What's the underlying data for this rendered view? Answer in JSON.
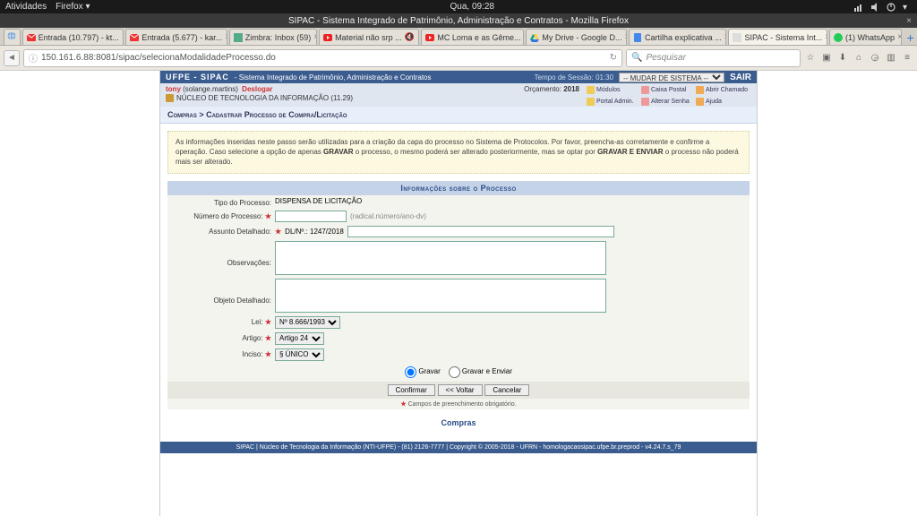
{
  "os": {
    "activities": "Atividades",
    "app": "Firefox ▾",
    "clock": "Qua, 09:28"
  },
  "firefox": {
    "window_title": "SIPAC - Sistema Integrado de Patrimônio, Administração e Contratos - Mozilla Firefox",
    "tabs": [
      {
        "label": "Entrada (10.797) - kt...",
        "icon": "gmail"
      },
      {
        "label": "Entrada (5.677) - kar...",
        "icon": "gmail"
      },
      {
        "label": "Zimbra: Inbox (59)",
        "icon": "zimbra"
      },
      {
        "label": "Material não srp ...",
        "icon": "youtube"
      },
      {
        "label": "MC Loma e as Gême...",
        "icon": "youtube"
      },
      {
        "label": "My Drive - Google D...",
        "icon": "drive"
      },
      {
        "label": "Cartilha explicativa ...",
        "icon": "doc"
      },
      {
        "label": "SIPAC - Sistema Int...",
        "icon": "sipac",
        "active": true
      },
      {
        "label": "(1) WhatsApp",
        "icon": "whatsapp"
      }
    ],
    "url": "150.161.6.88:8081/sipac/selecionaModalidadeProcesso.do",
    "search_placeholder": "Pesquisar"
  },
  "header": {
    "title": "UFPE - SIPAC",
    "subtitle": "- Sistema Integrado de Patrimônio, Administração e Contratos",
    "session": "Tempo de Sessão: 01:30",
    "sys_select": "-- MUDAR DE SISTEMA --",
    "sair": "SAIR",
    "user_prefix": "tony",
    "user_name": "(solange.martins)",
    "user_logout": "Deslogar",
    "unit": "NÚCLEO DE TECNOLOGIA DA INFORMAÇÃO (11.29)",
    "orcamento_label": "Orçamento:",
    "orcamento_year": "2018",
    "links": [
      {
        "label": "Módulos"
      },
      {
        "label": "Caixa Postal"
      },
      {
        "label": "Abrir Chamado"
      },
      {
        "label": "Portal Admin."
      },
      {
        "label": "Alterar Senha"
      },
      {
        "label": "Ajuda"
      }
    ]
  },
  "breadcrumb": "Compras > Cadastrar Processo de Compra/Licitação",
  "infobox": {
    "text1": "As informações inseridas neste passo serão utilizadas para a criação da capa do processo no Sistema de Protocolos. Por favor, preencha-as corretamente e confirme a operação. Caso selecione a opção de apenas ",
    "bold1": "GRAVAR",
    "text2": " o processo, o mesmo poderá ser alterado posteriormente, mas se optar por ",
    "bold2": "GRAVAR E ENVIAR",
    "text3": " o processo não poderá mais ser alterado."
  },
  "section_title": "Informações sobre o Processo",
  "form": {
    "tipo_label": "Tipo do Processo:",
    "tipo_value": "DISPENSA DE LICITAÇÃO",
    "numero_label": "Número do Processo:",
    "numero_hint": "(radical.número/ano-dv)",
    "assunto_label": "Assunto Detalhado:",
    "assunto_prefix": "DL/Nº.: 1247/2018",
    "obs_label": "Observações:",
    "objeto_label": "Objeto Detalhado:",
    "lei_label": "Lei:",
    "lei_value": "Nº 8.666/1993",
    "artigo_label": "Artigo:",
    "artigo_value": "Artigo 24",
    "inciso_label": "Inciso:",
    "inciso_value": "§ ÚNICO",
    "radio_gravar": "Gravar",
    "radio_gravar_enviar": "Gravar e Enviar",
    "btn_confirmar": "Confirmar",
    "btn_voltar": "<< Voltar",
    "btn_cancelar": "Cancelar",
    "req_note": "Campos de preenchimento obrigatório.",
    "compras_link": "Compras"
  },
  "footer": "SIPAC | Núcleo de Tecnologia da Informação (NTI-UFPE) - (81) 2126-7777 | Copyright © 2005-2018 - UFRN - homologacaosipac.ufpe.br.preprod - v4.24.7.s_79"
}
